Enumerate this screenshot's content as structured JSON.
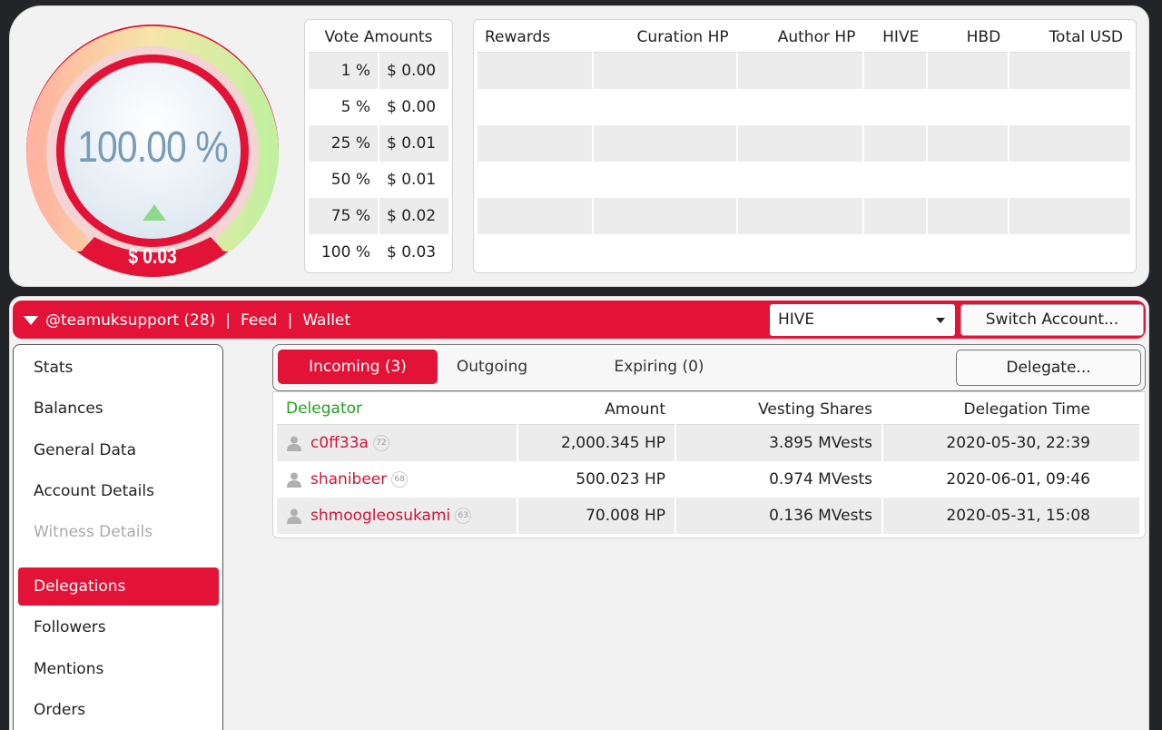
{
  "gauge": {
    "percent_label": "100.00 %",
    "value_label": "$ 0.03",
    "voting_power_fraction": 1.0
  },
  "vote_amounts": {
    "header": "Vote Amounts",
    "rows": [
      {
        "pct": "1 %",
        "usd": "$ 0.00"
      },
      {
        "pct": "5 %",
        "usd": "$ 0.00"
      },
      {
        "pct": "25 %",
        "usd": "$ 0.01"
      },
      {
        "pct": "50 %",
        "usd": "$ 0.01"
      },
      {
        "pct": "75 %",
        "usd": "$ 0.02"
      },
      {
        "pct": "100 %",
        "usd": "$ 0.03"
      }
    ]
  },
  "rewards": {
    "columns": [
      "Rewards",
      "Curation HP",
      "Author HP",
      "HIVE",
      "HBD",
      "Total USD"
    ]
  },
  "account_bar": {
    "account": "@teamuksupport (28)",
    "separator": "|",
    "feed": "Feed",
    "wallet": "Wallet",
    "currency_select": "HIVE",
    "switch_account": "Switch Account..."
  },
  "sidebar": {
    "items": [
      {
        "label": "Stats"
      },
      {
        "label": "Balances"
      },
      {
        "label": "General Data"
      },
      {
        "label": "Account Details"
      },
      {
        "label": "Witness Details"
      },
      {
        "label": "Delegations"
      },
      {
        "label": "Followers"
      },
      {
        "label": "Mentions"
      },
      {
        "label": "Orders"
      }
    ]
  },
  "tabs": {
    "incoming": "Incoming (3)",
    "outgoing": "Outgoing",
    "expiring": "Expiring (0)",
    "delegate_button": "Delegate..."
  },
  "delegations": {
    "columns": [
      "Delegator",
      "Amount",
      "Vesting Shares",
      "Delegation Time"
    ],
    "rows": [
      {
        "name": "c0ff33a",
        "rep": "72",
        "amount": "2,000.345 HP",
        "vests": "3.895 MVests",
        "time": "2020-05-30, 22:39"
      },
      {
        "name": "shanibeer",
        "rep": "68",
        "amount": "500.023 HP",
        "vests": "0.974 MVests",
        "time": "2020-06-01, 09:46"
      },
      {
        "name": "shmoogleosukami",
        "rep": "63",
        "amount": "70.008 HP",
        "vests": "0.136 MVests",
        "time": "2020-05-31, 15:08"
      }
    ]
  },
  "colors": {
    "accent": "#e31337",
    "header_green": "#1fa31f"
  }
}
